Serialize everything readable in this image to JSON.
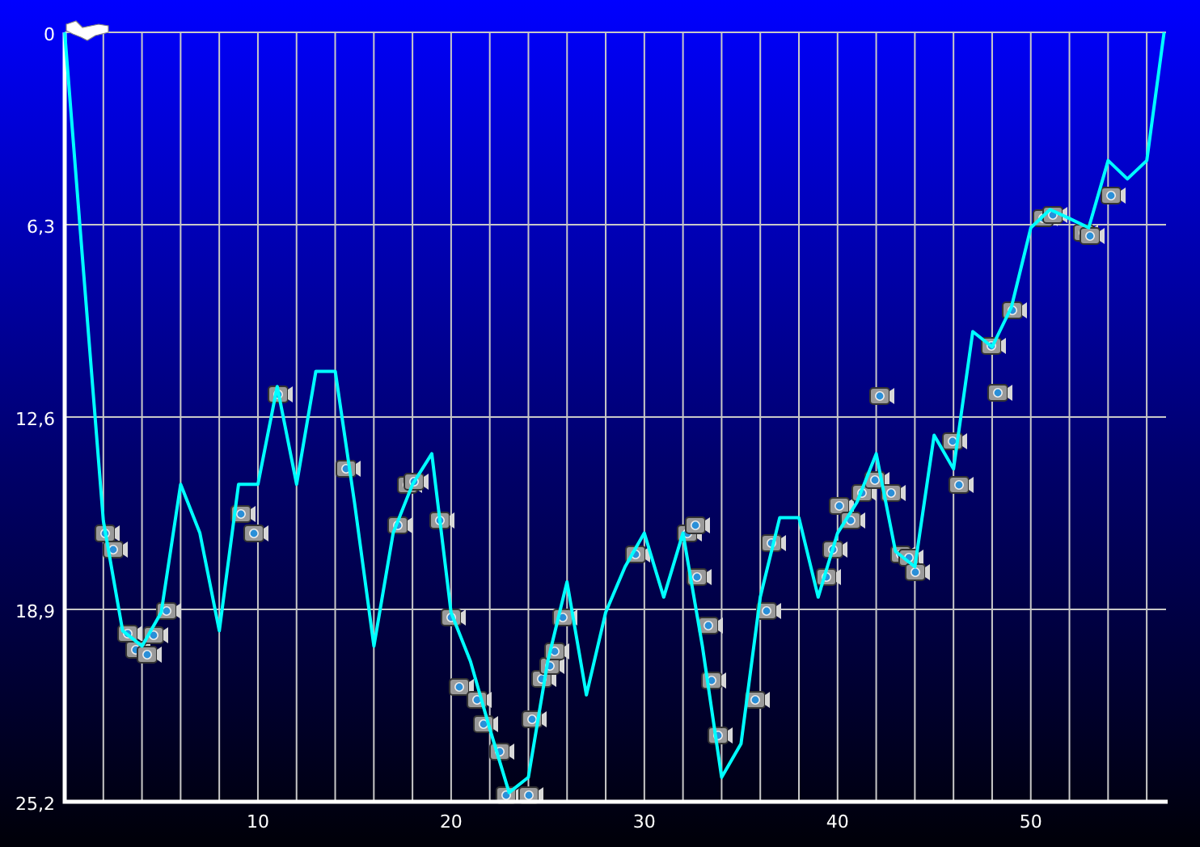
{
  "chart_data": {
    "type": "line",
    "x": [
      0,
      1,
      2,
      3,
      4,
      5,
      6,
      7,
      8,
      9,
      10,
      11,
      12,
      13,
      14,
      15,
      16,
      17,
      18,
      19,
      20,
      21,
      22,
      23,
      24,
      25,
      26,
      27,
      28,
      29,
      30,
      31,
      32,
      33,
      34,
      35,
      36,
      37,
      38,
      39,
      40,
      41,
      42,
      43,
      44,
      45,
      46,
      47,
      48,
      49,
      50,
      51,
      52,
      53,
      54,
      55,
      56,
      56.9
    ],
    "series": [
      {
        "color": "#00ffff",
        "values": [
          0,
          8,
          16,
          19.6,
          20.1,
          19,
          14.8,
          16.4,
          19.6,
          14.8,
          14.8,
          11.6,
          14.8,
          11.1,
          11.1,
          15.4,
          20.1,
          16.4,
          14.8,
          13.8,
          19,
          20.6,
          22.8,
          24.9,
          24.4,
          20.6,
          18,
          21.7,
          19,
          17.5,
          16.4,
          18.5,
          16.4,
          20.1,
          24.4,
          23.3,
          18.5,
          15.9,
          15.9,
          18.5,
          16.4,
          15.4,
          13.8,
          17,
          17.5,
          13.2,
          14.3,
          9.8,
          10.3,
          9,
          6.4,
          5.8,
          6.1,
          6.4,
          4.2,
          4.8,
          4.2,
          0
        ]
      }
    ],
    "xlim": [
      0,
      57
    ],
    "ylim": [
      25.2,
      0
    ],
    "grid": true,
    "xticks": [
      10,
      20,
      30,
      40,
      50
    ],
    "yticks": [
      {
        "value": 0,
        "label": "0"
      },
      {
        "value": 6.3,
        "label": "6,3"
      },
      {
        "value": 12.6,
        "label": "12,6"
      },
      {
        "value": 18.9,
        "label": "18,9"
      },
      {
        "value": 25.2,
        "label": "25,2"
      }
    ]
  }
}
